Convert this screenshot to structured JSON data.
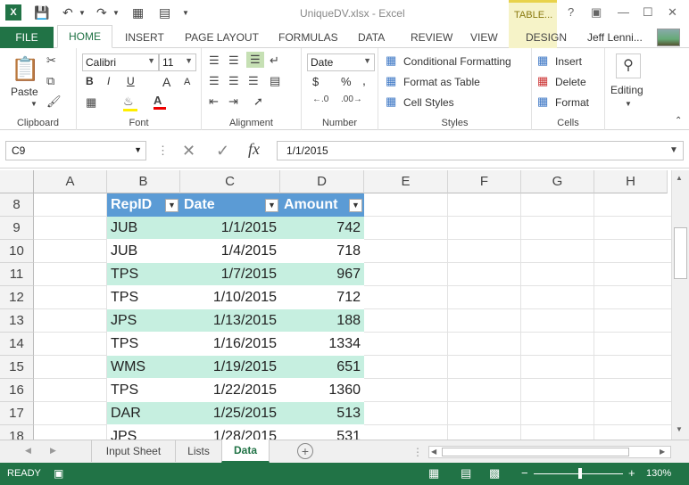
{
  "window": {
    "title": "UniqueDV.xlsx - Excel",
    "context_tab": "TABLE...",
    "user": "Jeff Lenni...",
    "help": "?"
  },
  "tabs": [
    "FILE",
    "HOME",
    "INSERT",
    "PAGE LAYOUT",
    "FORMULAS",
    "DATA",
    "REVIEW",
    "VIEW",
    "DESIGN"
  ],
  "ribbon": {
    "clipboard": {
      "label": "Clipboard",
      "paste": "Paste"
    },
    "font": {
      "label": "Font",
      "name": "Calibri",
      "size": "11",
      "bold": "B",
      "italic": "I",
      "underline": "U",
      "grow": "A",
      "shrink": "A"
    },
    "alignment": {
      "label": "Alignment"
    },
    "number": {
      "label": "Number",
      "format": "Date",
      "currency": "$",
      "percent": "%",
      "comma": ","
    },
    "styles": {
      "label": "Styles",
      "conditional": "Conditional Formatting",
      "format_table": "Format as Table",
      "cell_styles": "Cell Styles"
    },
    "cells": {
      "label": "Cells",
      "insert": "Insert",
      "delete": "Delete",
      "format": "Format"
    },
    "editing": {
      "label": "Editing"
    }
  },
  "formula_bar": {
    "name_box": "C9",
    "formula": "1/1/2015",
    "fx": "fx"
  },
  "columns": [
    "A",
    "B",
    "C",
    "D",
    "E",
    "F",
    "G",
    "H"
  ],
  "rows": [
    "8",
    "9",
    "10",
    "11",
    "12",
    "13",
    "14",
    "15",
    "16",
    "17",
    "18"
  ],
  "table": {
    "headers": [
      "RepID",
      "Date",
      "Amount"
    ],
    "data": [
      [
        "JUB",
        "1/1/2015",
        "742"
      ],
      [
        "JUB",
        "1/4/2015",
        "718"
      ],
      [
        "TPS",
        "1/7/2015",
        "967"
      ],
      [
        "TPS",
        "1/10/2015",
        "712"
      ],
      [
        "JPS",
        "1/13/2015",
        "188"
      ],
      [
        "TPS",
        "1/16/2015",
        "1334"
      ],
      [
        "WMS",
        "1/19/2015",
        "651"
      ],
      [
        "TPS",
        "1/22/2015",
        "1360"
      ],
      [
        "DAR",
        "1/25/2015",
        "513"
      ],
      [
        "JPS",
        "1/28/2015",
        "531"
      ]
    ]
  },
  "sheets": [
    "Input Sheet",
    "Lists",
    "Data"
  ],
  "active_sheet": "Data",
  "status": {
    "mode": "READY",
    "zoom": "130%",
    "minus": "−",
    "plus": "+"
  },
  "colors": {
    "excel_green": "#217346",
    "table_header": "#5b9bd5",
    "band": "#ddebf7",
    "band_alt": "#c6efe0"
  }
}
